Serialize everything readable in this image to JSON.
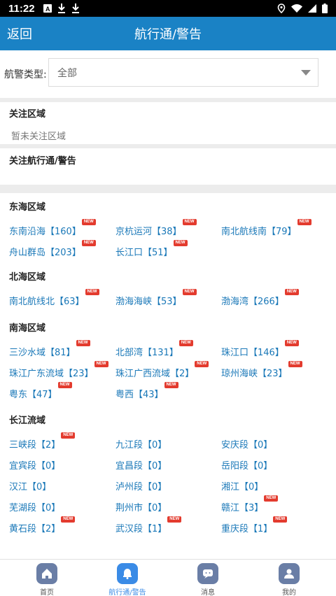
{
  "status": {
    "time": "11:22"
  },
  "header": {
    "back_label": "返回",
    "title": "航行通/警告"
  },
  "filter": {
    "label": "航警类型:",
    "selected": "全部"
  },
  "focus_area": {
    "title": "关注区域",
    "empty": "暂未关注区域"
  },
  "focus_notice": {
    "title": "关注航行通/警告"
  },
  "regions": [
    {
      "title": "东海区域",
      "items": [
        {
          "label": "东南沿海【160】",
          "new": "NEW"
        },
        {
          "label": "京杭运河【38】",
          "new": "NEW"
        },
        {
          "label": "南北航线南【79】",
          "new": "NEW"
        },
        {
          "label": "舟山群岛【203】",
          "new": "NEW"
        },
        {
          "label": "长江口【51】",
          "new": "NEW"
        }
      ]
    },
    {
      "title": "北海区域",
      "items": [
        {
          "label": "南北航线北【63】",
          "new": "NEW"
        },
        {
          "label": "渤海海峡【53】",
          "new": "NEW"
        },
        {
          "label": "渤海湾【266】",
          "new": "NEW"
        }
      ]
    },
    {
      "title": "南海区域",
      "items": [
        {
          "label": "三沙水域【81】",
          "new": "NEW"
        },
        {
          "label": "北部湾【131】",
          "new": "NEW"
        },
        {
          "label": "珠江口【146】",
          "new": "NEW"
        },
        {
          "label": "珠江广东流域【23】",
          "new": "NEW"
        },
        {
          "label": "珠江广西流域【2】",
          "new": "NEW"
        },
        {
          "label": "琼州海峡【23】",
          "new": "NEW"
        },
        {
          "label": "粤东【47】",
          "new": "NEW"
        },
        {
          "label": "粤西【43】",
          "new": "NEW"
        }
      ]
    },
    {
      "title": "长江流域",
      "items": [
        {
          "label": "三峡段【2】",
          "new": "NEW"
        },
        {
          "label": "九江段【0】",
          "new": ""
        },
        {
          "label": "安庆段【0】",
          "new": ""
        },
        {
          "label": "宜宾段【0】",
          "new": ""
        },
        {
          "label": "宜昌段【0】",
          "new": ""
        },
        {
          "label": "岳阳段【0】",
          "new": ""
        },
        {
          "label": "汉江【0】",
          "new": ""
        },
        {
          "label": "泸州段【0】",
          "new": ""
        },
        {
          "label": "湘江【0】",
          "new": ""
        },
        {
          "label": "芜湖段【0】",
          "new": ""
        },
        {
          "label": "荆州市【0】",
          "new": ""
        },
        {
          "label": "赣江【3】",
          "new": "NEW"
        },
        {
          "label": "黄石段【2】",
          "new": "NEW"
        },
        {
          "label": "武汉段【1】",
          "new": "NEW"
        },
        {
          "label": "重庆段【1】",
          "new": "NEW"
        }
      ]
    }
  ],
  "bottom_nav": [
    {
      "label": "首页",
      "icon": "home-icon",
      "color": "#6a7ea6"
    },
    {
      "label": "航行通/警告",
      "icon": "notice-icon",
      "color": "#3a8be6"
    },
    {
      "label": "消息",
      "icon": "message-icon",
      "color": "#6a7ea6"
    },
    {
      "label": "我的",
      "icon": "profile-icon",
      "color": "#6a7ea6"
    }
  ],
  "colors": {
    "accent": "#1a82c5",
    "link": "#1a78b8",
    "new_badge": "#e33b2e"
  }
}
